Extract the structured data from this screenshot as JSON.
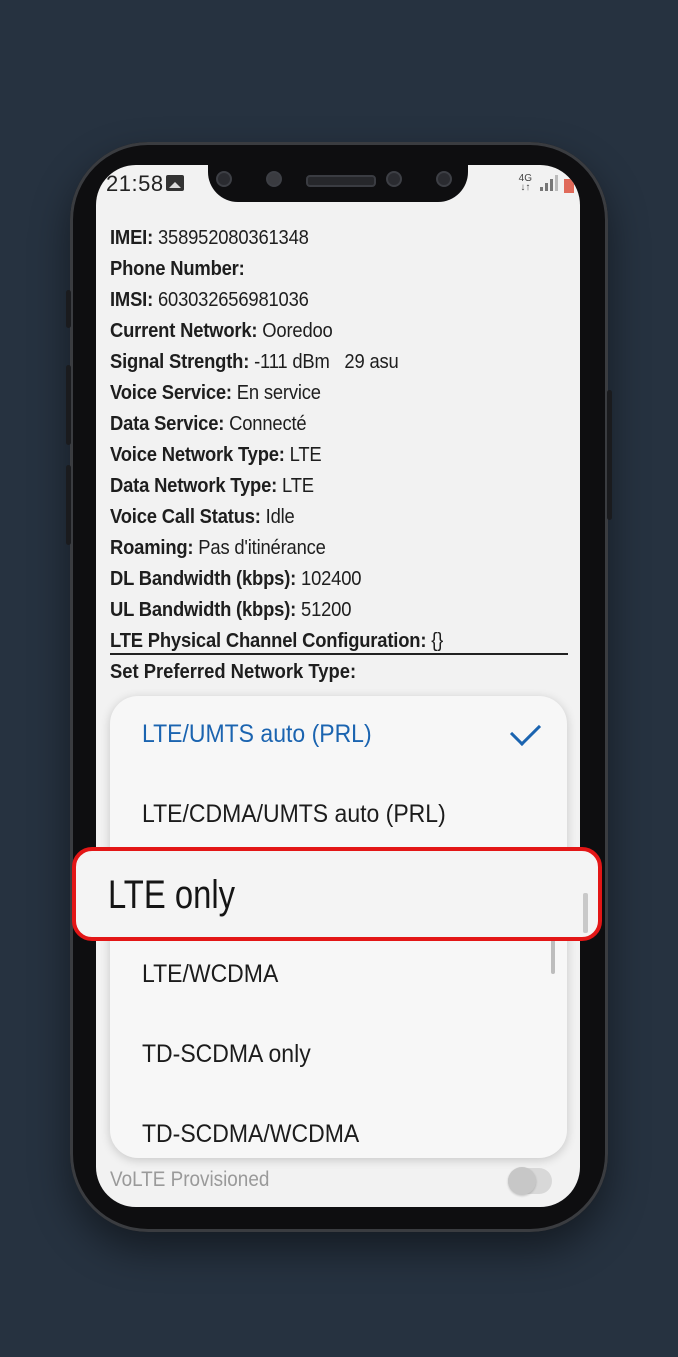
{
  "status_bar": {
    "time": "21:58",
    "network_indicator": "4G",
    "icons": [
      "gallery-icon",
      "signal-icon",
      "battery-icon"
    ]
  },
  "phone_info": {
    "rows": [
      {
        "label": "IMEI:",
        "value": " 358952080361348"
      },
      {
        "label": "Phone Number:",
        "value": ""
      },
      {
        "label": "IMSI:",
        "value": " 603032656981036"
      },
      {
        "label": "Current Network:",
        "value": " Ooredoo"
      },
      {
        "label": "Signal Strength:",
        "value": " -111 dBm   29 asu"
      },
      {
        "label": "Voice Service:",
        "value": " En service"
      },
      {
        "label": "Data Service:",
        "value": " Connecté"
      },
      {
        "label": "Voice Network Type:",
        "value": " LTE"
      },
      {
        "label": "Data Network Type:",
        "value": " LTE"
      },
      {
        "label": "Voice Call Status:",
        "value": " Idle"
      },
      {
        "label": "Roaming:",
        "value": " Pas d'itinérance"
      },
      {
        "label": "DL Bandwidth (kbps):",
        "value": " 102400"
      },
      {
        "label": "UL Bandwidth (kbps):",
        "value": " 51200"
      },
      {
        "label": "LTE Physical Channel Configuration:",
        "value": " {}"
      }
    ],
    "preferred_network_label": "Set Preferred Network Type:"
  },
  "network_type_dropdown": {
    "options": [
      {
        "label": "LTE/UMTS auto (PRL)",
        "selected": true
      },
      {
        "label": "LTE/CDMA/UMTS auto (PRL)",
        "selected": false
      },
      {
        "label": "LTE only",
        "selected": false
      },
      {
        "label": "LTE/WCDMA",
        "selected": false
      },
      {
        "label": "TD-SCDMA only",
        "selected": false
      },
      {
        "label": "TD-SCDMA/WCDMA",
        "selected": false
      }
    ],
    "highlighted_option": "LTE only",
    "highlight_color": "#e31616",
    "selected_color": "#1b64b0"
  },
  "settings": {
    "volte_label": "VoLTE Provisioned",
    "volte_enabled": false
  }
}
